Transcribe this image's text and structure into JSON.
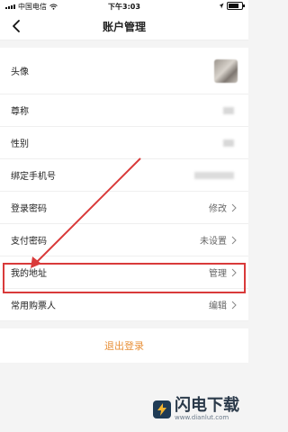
{
  "status_bar": {
    "carrier": "中国电信",
    "time": "下午3:03",
    "wifi_icon": "wifi-icon",
    "battery_icon": "battery-icon"
  },
  "nav": {
    "title": "账户管理",
    "back_icon": "chevron-left-icon"
  },
  "rows": [
    {
      "label": "头像",
      "value": ""
    },
    {
      "label": "尊称",
      "value": ""
    },
    {
      "label": "性别",
      "value": ""
    },
    {
      "label": "绑定手机号",
      "value": ""
    },
    {
      "label": "登录密码",
      "value": "修改"
    },
    {
      "label": "支付密码",
      "value": "未设置"
    },
    {
      "label": "我的地址",
      "value": "管理"
    },
    {
      "label": "常用购票人",
      "value": "编辑"
    }
  ],
  "logout_label": "退出登录",
  "watermark": {
    "title": "闪电下载",
    "url": "www.dianlut.com"
  },
  "colors": {
    "highlight": "#d93a3a",
    "logout": "#e8913a"
  }
}
